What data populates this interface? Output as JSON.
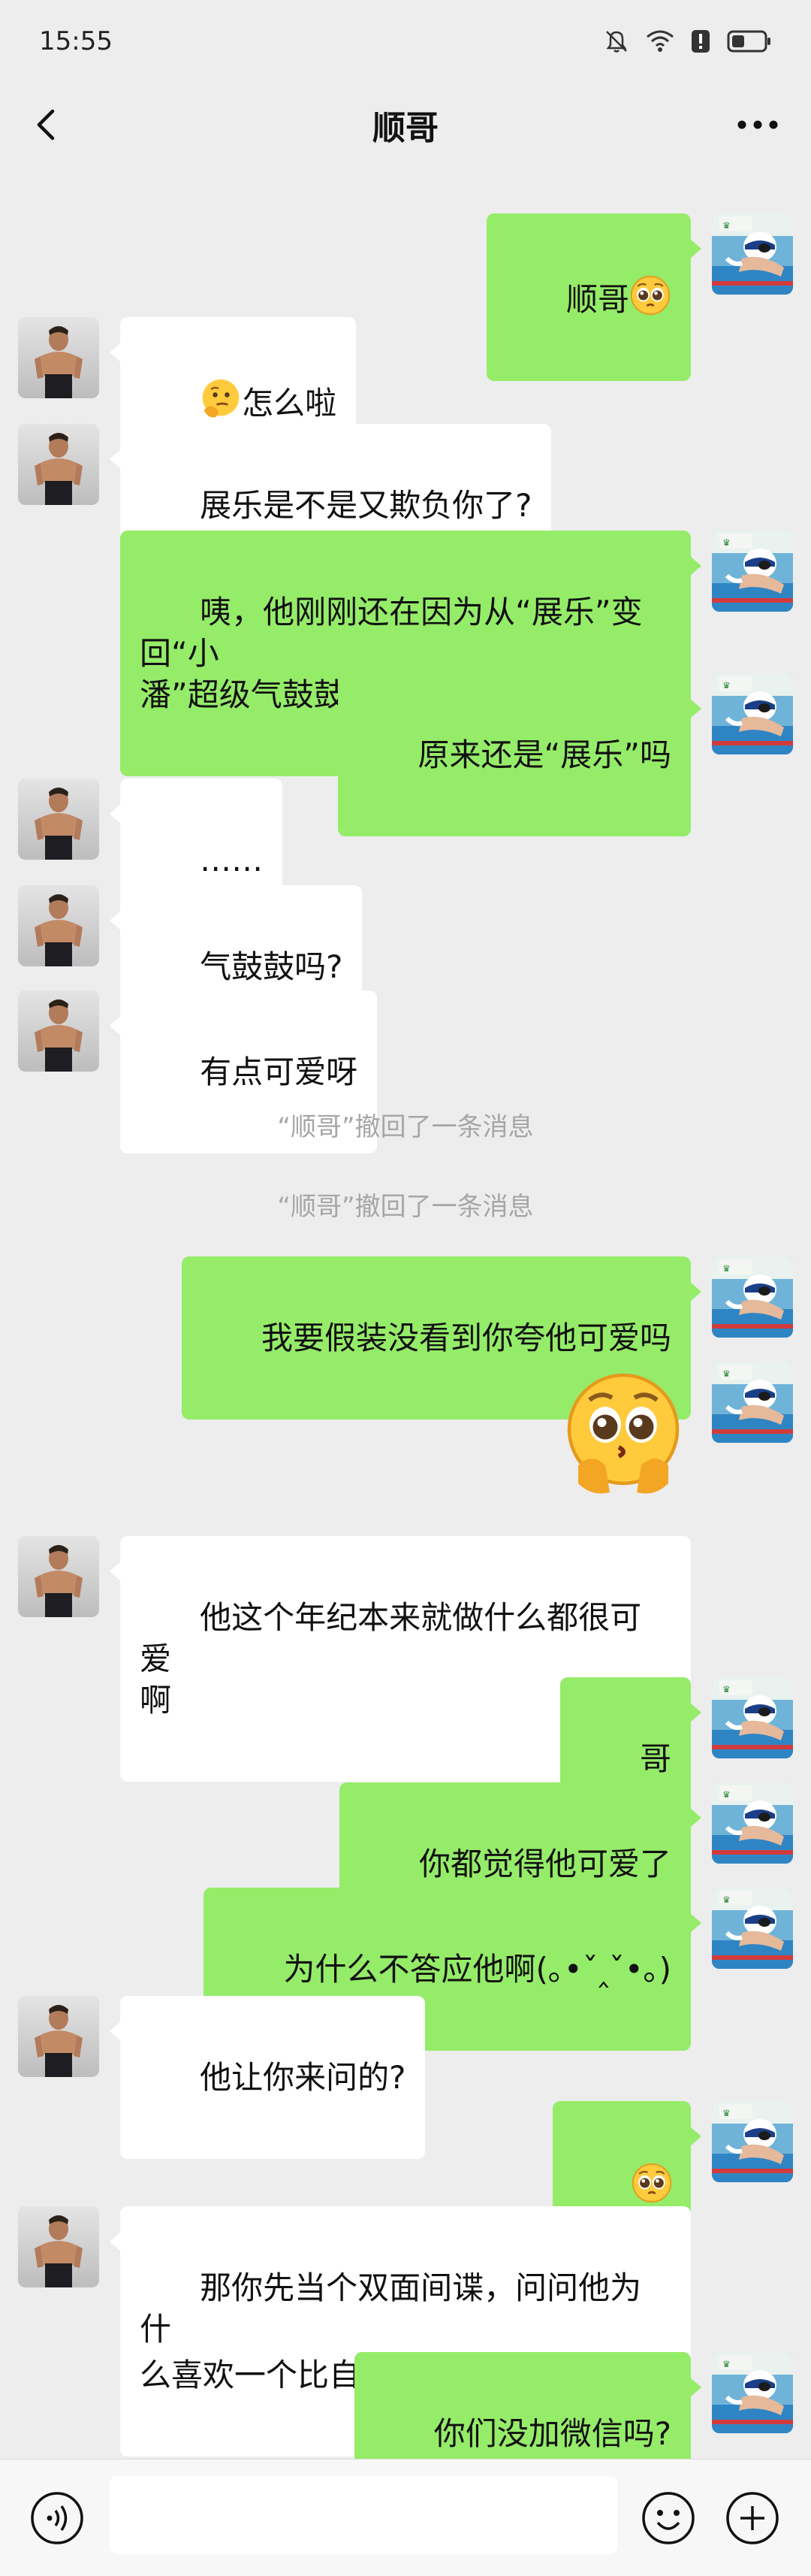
{
  "status_bar": {
    "time": "15:55"
  },
  "header": {
    "title": "顺哥"
  },
  "messages": [
    {
      "text": "顺哥"
    },
    {
      "text": "怎么啦"
    },
    {
      "text": "展乐是不是又欺负你了?"
    },
    {
      "text": "咦，他刚刚还在因为从“展乐”变回“小\n潘”超级气鼓鼓"
    },
    {
      "text": "原来还是“展乐”吗"
    },
    {
      "text": "……"
    },
    {
      "text": "气鼓鼓吗?"
    },
    {
      "text": "有点可爱呀"
    },
    {
      "text": "“顺哥”撤回了一条消息"
    },
    {
      "text": "“顺哥”撤回了一条消息"
    },
    {
      "text": "我要假装没看到你夸他可爱吗"
    },
    {
      "text": "他这个年纪本来就做什么都很可爱\n啊"
    },
    {
      "text": "哥"
    },
    {
      "text": "你都觉得他可爱了"
    },
    {
      "text": "为什么不答应他啊(｡•ˇ‸ˇ•｡)"
    },
    {
      "text": "他让你来问的?"
    },
    {
      "text": "那你先当个双面间谍，问问他为什\n么喜欢一个比自己大十岁的人吧"
    },
    {
      "text": "你们没加微信吗?"
    }
  ],
  "colors": {
    "background": "#ededed",
    "incoming_bubble": "#ffffff",
    "outgoing_bubble": "#95ec69",
    "recall_text": "#a6a6a6"
  },
  "icons": [
    "back-arrow-icon",
    "more-icon",
    "voice-icon",
    "emoji-icon",
    "plus-icon",
    "pleading-face-emoji",
    "thinking-face-emoji",
    "laughing-tears-emoji",
    "mute-icon",
    "wifi-icon",
    "alert-icon",
    "battery-icon"
  ]
}
